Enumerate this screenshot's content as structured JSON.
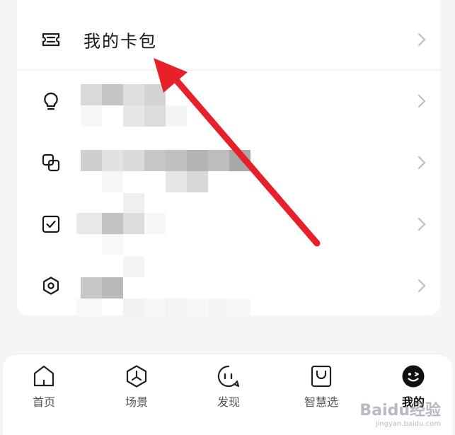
{
  "menu": {
    "items": [
      {
        "label": "我的卡包",
        "icon": "ticket-icon"
      },
      {
        "label": "",
        "icon": "lightbulb-icon"
      },
      {
        "label": "",
        "icon": "link-squares-icon"
      },
      {
        "label": "",
        "icon": "checkbox-icon"
      },
      {
        "label": "",
        "icon": "hexagon-settings-icon"
      }
    ]
  },
  "tabbar": {
    "tabs": [
      {
        "label": "首页",
        "icon": "home-icon"
      },
      {
        "label": "场景",
        "icon": "scene-hexagon-icon"
      },
      {
        "label": "发现",
        "icon": "discover-face-icon"
      },
      {
        "label": "智慧选",
        "icon": "shopping-bag-icon"
      },
      {
        "label": "我的",
        "icon": "smiley-avatar-icon",
        "active": true
      }
    ]
  },
  "watermark": {
    "brand": "Baidu经验",
    "url": "jingyan.baidu.com"
  },
  "colors": {
    "arrow": "#e8202a",
    "background": "#f5f5f5",
    "card": "#ffffff"
  }
}
